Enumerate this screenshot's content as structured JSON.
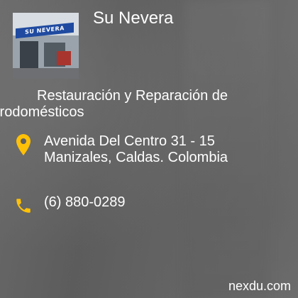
{
  "business": {
    "name": "Su Nevera",
    "sign_text": "SU NEVERA",
    "description_line1": "Restauración y Reparación de",
    "description_line2": "trodomésticos"
  },
  "address": {
    "line1": "Avenida Del Centro 31 - 15",
    "line2": "Manizales, Caldas. Colombia",
    "icon": "location-pin-icon"
  },
  "phone": {
    "number": "(6) 880-0289",
    "icon": "phone-icon"
  },
  "footer": {
    "brand": "nexdu.com"
  },
  "colors": {
    "accent": "#ffc107",
    "text": "#ffffff",
    "background": "#5f5f5f"
  }
}
